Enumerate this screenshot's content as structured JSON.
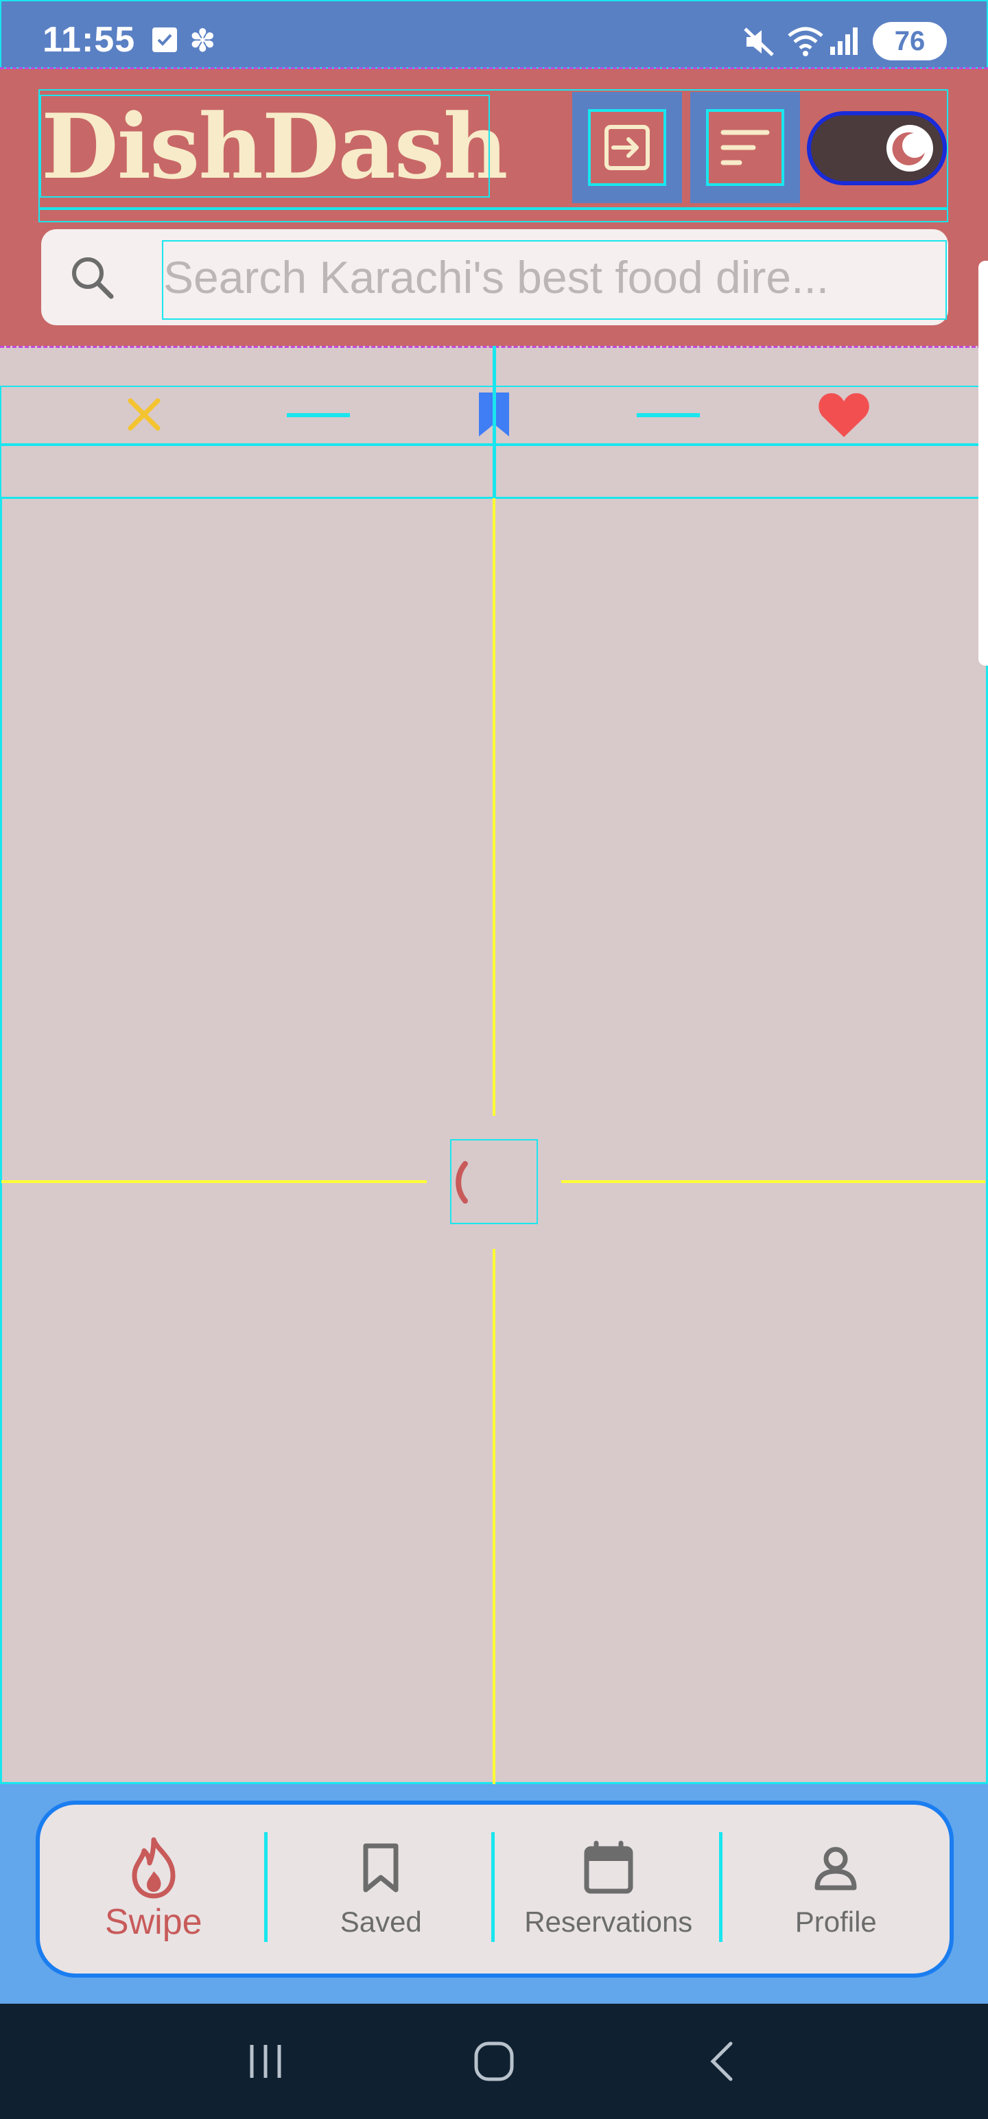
{
  "status_bar": {
    "time": "11:55",
    "battery": "76",
    "icons": [
      "check-notification-icon",
      "fan-icon",
      "mute-icon",
      "wifi-icon",
      "signal-icon",
      "battery-icon"
    ]
  },
  "header": {
    "title": "DishDash",
    "login_button_icon": "login-icon",
    "filter_button_icon": "sort-icon",
    "theme_toggle_icon": "moon-icon"
  },
  "search": {
    "placeholder": "Search Karachi's best food dire..."
  },
  "actions": {
    "dislike_icon": "close-icon",
    "save_icon": "bookmark-icon",
    "like_icon": "heart-icon"
  },
  "bottom_nav": {
    "items": [
      {
        "label": "Swipe",
        "icon": "flame-icon",
        "active": true
      },
      {
        "label": "Saved",
        "icon": "bookmark-outline-icon",
        "active": false
      },
      {
        "label": "Reservations",
        "icon": "calendar-icon",
        "active": false
      },
      {
        "label": "Profile",
        "icon": "person-icon",
        "active": false
      }
    ]
  },
  "colors": {
    "header_bg": "#c86767",
    "title_color": "#f7ebc9",
    "status_bar_bg": "#5a80c4",
    "body_bg": "#d8c9cb",
    "accent_active": "#c85a5a",
    "like_color": "#f25050",
    "save_color": "#3f7ef5",
    "dislike_color": "#f4c430",
    "nav_outline": "#1a7df0",
    "system_nav_bg": "#0f2130"
  }
}
